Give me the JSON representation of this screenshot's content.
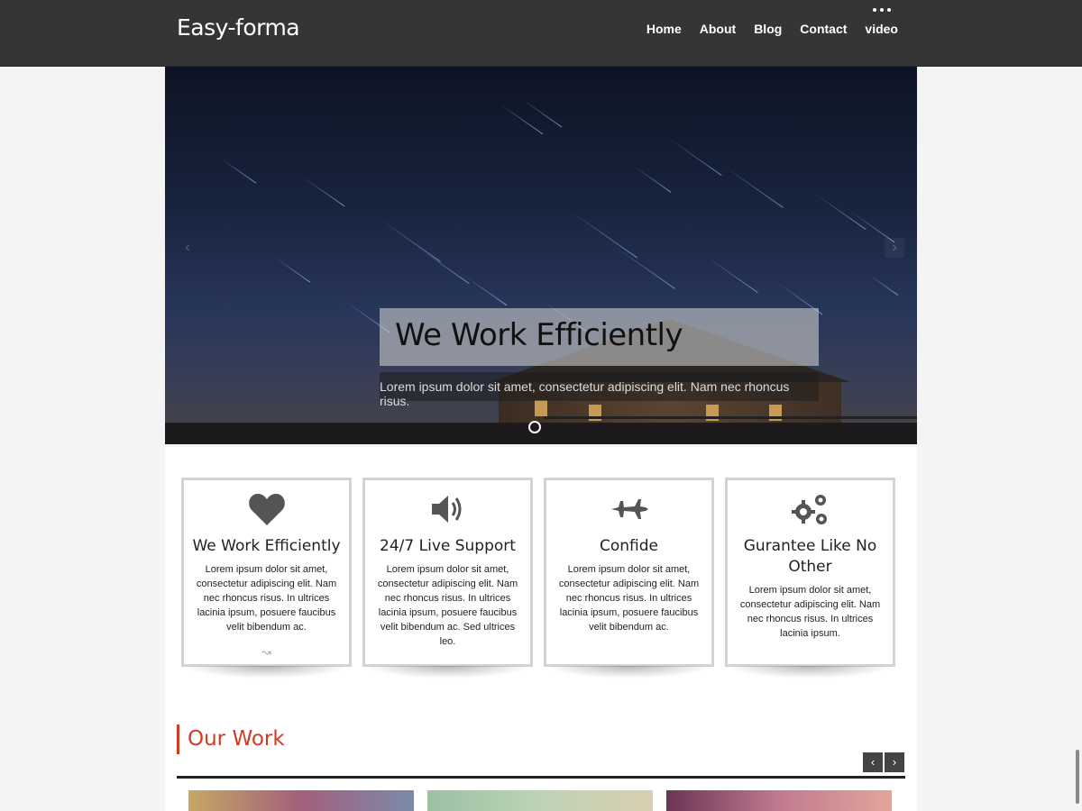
{
  "header": {
    "brand": "Easy-forma",
    "nav": [
      {
        "label": "Home"
      },
      {
        "label": "About"
      },
      {
        "label": "Blog"
      },
      {
        "label": "Contact"
      },
      {
        "label": "video"
      }
    ]
  },
  "hero": {
    "title": "We Work Efficiently",
    "text": "Lorem ipsum dolor sit amet, consectetur adipiscing elit. Nam nec rhoncus risus.",
    "prev_icon": "chevron-left-icon",
    "next_icon": "chevron-right-icon"
  },
  "features": [
    {
      "icon": "heart-icon",
      "title": "We Work Efficiently",
      "text": "Lorem ipsum dolor sit amet, consectetur adipiscing elit. Nam nec rhoncus risus. In ultrices lacinia ipsum, posuere faucibus velit bibendum ac.",
      "more": "↝"
    },
    {
      "icon": "volume-icon",
      "title": "24/7 Live Support",
      "text": "Lorem ipsum dolor sit amet, consectetur adipiscing elit. Nam nec rhoncus risus. In ultrices lacinia ipsum, posuere faucibus velit bibendum ac. Sed ultrices leo."
    },
    {
      "icon": "plane-icon",
      "title": "Confide",
      "text": "Lorem ipsum dolor sit amet, consectetur adipiscing elit. Nam nec rhoncus risus. In ultrices lacinia ipsum, posuere faucibus velit bibendum ac."
    },
    {
      "icon": "gears-icon",
      "title": "Gurantee Like No Other",
      "text": "Lorem ipsum dolor sit amet, consectetur adipiscing elit. Nam nec rhoncus risus. In ultrices lacinia ipsum."
    }
  ],
  "work": {
    "title": "Our Work",
    "prev": "‹",
    "next": "›"
  },
  "colors": {
    "header_bg": "#353535",
    "accent": "#d23b23"
  }
}
